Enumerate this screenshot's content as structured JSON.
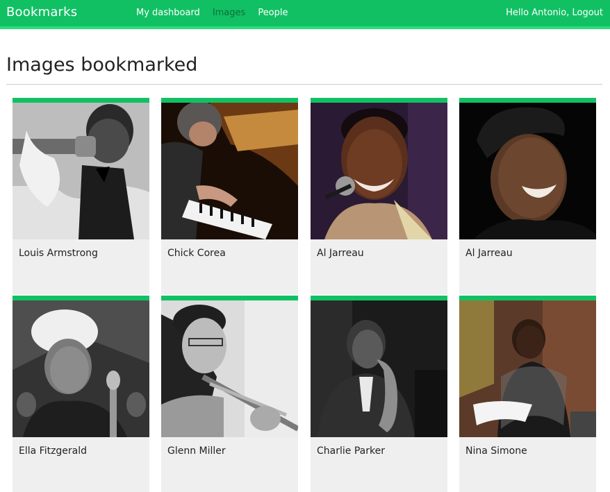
{
  "header": {
    "logo": "Bookmarks",
    "nav": [
      {
        "label": "My dashboard",
        "selected": false
      },
      {
        "label": "Images",
        "selected": true
      },
      {
        "label": "People",
        "selected": false
      }
    ],
    "greeting": "Hello Antonio,",
    "logout": "Logout"
  },
  "page": {
    "title": "Images bookmarked"
  },
  "images": [
    {
      "title": "Louis Armstrong",
      "icon": "trumpet-photo"
    },
    {
      "title": "Chick Corea",
      "icon": "piano-photo"
    },
    {
      "title": "Al Jarreau",
      "icon": "microphone-photo"
    },
    {
      "title": "Al Jarreau",
      "icon": "portrait-photo"
    },
    {
      "title": "Ella Fitzgerald",
      "icon": "singer-photo"
    },
    {
      "title": "Glenn Miller",
      "icon": "trombone-photo"
    },
    {
      "title": "Charlie Parker",
      "icon": "saxophone-photo"
    },
    {
      "title": "Nina Simone",
      "icon": "portrait-photo"
    }
  ],
  "colors": {
    "brand": "#12c064",
    "brand_light": "#2ddc7a",
    "selected_nav": "#0a6e38",
    "card_bg": "#efefef"
  }
}
